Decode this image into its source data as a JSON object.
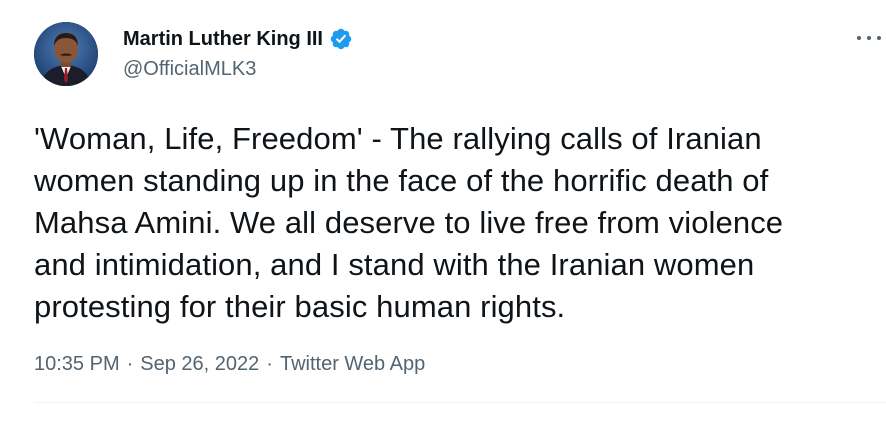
{
  "author": {
    "display_name": "Martin Luther King III",
    "handle": "@OfficialMLK3",
    "verified": true
  },
  "tweet": {
    "text": "'Woman, Life, Freedom' - The rallying calls of Iranian\nwomen standing up in the face of the horrific death of\nMahsa Amini. We all deserve to live free from violence\nand intimidation, and I stand with the Iranian women\nprotesting for their basic human rights.",
    "time": "10:35 PM",
    "date": "Sep 26, 2022",
    "source": "Twitter Web App",
    "separator": "·"
  },
  "icons": {
    "verified": "verified-badge-icon",
    "more": "more-options-icon"
  },
  "colors": {
    "accent": "#1d9bf0",
    "text_primary": "#0f1419",
    "text_secondary": "#536471",
    "divider": "#eff3f4"
  }
}
